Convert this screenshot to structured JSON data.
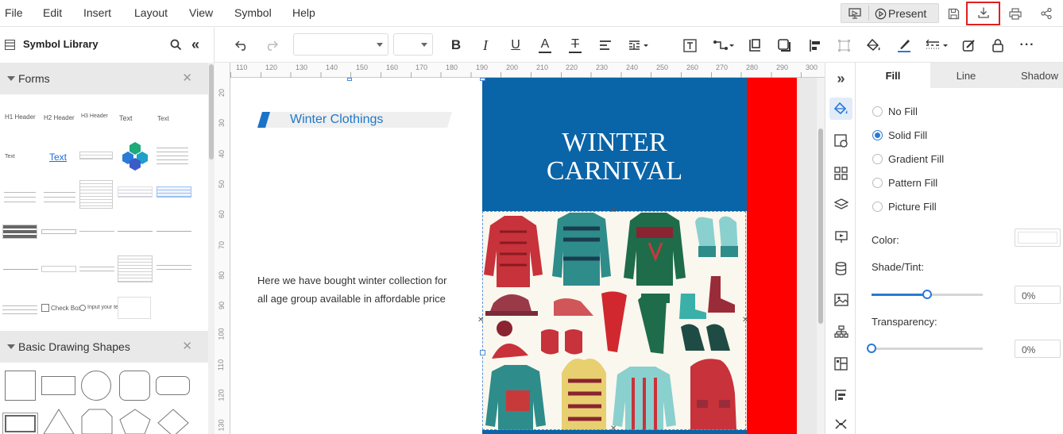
{
  "menubar": {
    "items": [
      "File",
      "Edit",
      "Insert",
      "Layout",
      "View",
      "Symbol",
      "Help"
    ],
    "present_label": "Present"
  },
  "library": {
    "title": "Symbol Library",
    "sections": [
      "Forms",
      "Basic Drawing Shapes"
    ],
    "forms_samples": {
      "h1": "H1 Header",
      "h2": "H2 Header",
      "h3": "H3 Header",
      "text1": "Text",
      "text2": "Text",
      "text3": "Text",
      "link_text": "Text",
      "checkbox": "Check Box",
      "radio": "Input your text"
    }
  },
  "ruler": {
    "top_labels": [
      "110",
      "120",
      "130",
      "140",
      "150",
      "160",
      "170",
      "180",
      "190",
      "200",
      "210",
      "220",
      "230",
      "240",
      "250",
      "260",
      "270",
      "280",
      "290",
      "300"
    ],
    "left_labels": [
      "20",
      "30",
      "40",
      "50",
      "60",
      "70",
      "80",
      "90",
      "100",
      "110",
      "120",
      "130"
    ]
  },
  "canvas": {
    "heading": "Winter Clothings",
    "paragraph": "Here we have bought winter collection for all age group available in affordable price",
    "banner_line1": "WINTER",
    "banner_line2": "CARNIVAL",
    "colors": {
      "banner": "#0a64a8",
      "red_strip": "#ff0000",
      "illustration_bg": "#faf7ee"
    }
  },
  "props": {
    "tabs": [
      "Fill",
      "Line",
      "Shadow"
    ],
    "fill_options": [
      "No Fill",
      "Solid Fill",
      "Gradient Fill",
      "Pattern Fill",
      "Picture Fill"
    ],
    "selected_fill": "Solid Fill",
    "color_label": "Color:",
    "shade_label": "Shade/Tint:",
    "shade_value": "0%",
    "shade_level": 0.5,
    "transparency_label": "Transparency:",
    "transparency_value": "0%",
    "transparency_level": 0,
    "accent": "#2b79d6"
  }
}
